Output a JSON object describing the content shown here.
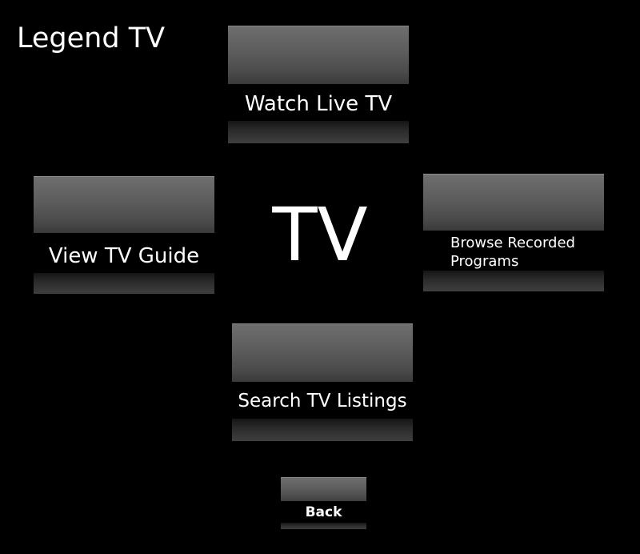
{
  "app": {
    "title": "Legend TV",
    "center_label": "TV"
  },
  "menu": {
    "watch_live_tv": "Watch Live TV",
    "view_tv_guide": "View TV Guide",
    "browse_recorded_line1": "Browse Recorded",
    "browse_recorded_line2": "Programs",
    "search_tv_listings": "Search TV Listings",
    "back": "Back"
  },
  "colors": {
    "background": "#000000",
    "tile_gloss_top": "#6e6e6e",
    "tile_gloss_bottom": "#3a3a3a",
    "text": "#ffffff"
  }
}
